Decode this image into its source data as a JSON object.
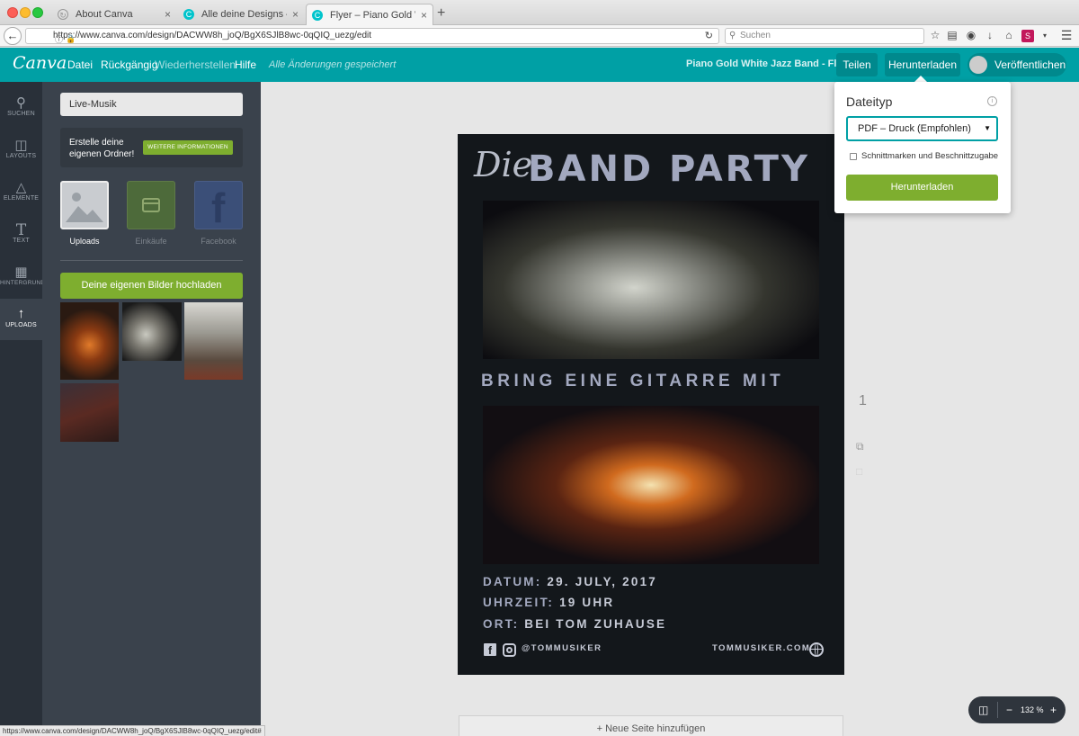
{
  "browser": {
    "tabs": [
      {
        "title": "About Canva",
        "active": false
      },
      {
        "title": "Alle deine Designs – Canva",
        "active": false
      },
      {
        "title": "Flyer – Piano Gold White Jazz",
        "active": true
      }
    ],
    "url": "https://www.canva.com/design/DACWW8h_joQ/BgX6SJlB8wc-0qQIQ_uezg/edit",
    "search_placeholder": "Suchen",
    "status_url": "https://www.canva.com/design/DACWW8h_joQ/BgX6SJlB8wc-0qQIQ_uezg/edit#"
  },
  "topbar": {
    "logo": "Canva",
    "menu": {
      "file": "Datei",
      "undo": "Rückgängig",
      "redo": "Wiederherstellen",
      "help": "Hilfe"
    },
    "saved_note": "Alle Änderungen gespeichert",
    "design_title": "Piano Gold White Jazz Band - Flyer",
    "share": "Teilen",
    "download": "Herunterladen",
    "publish": "Veröffentlichen",
    "accent_color": "#00a0a5"
  },
  "rail": {
    "search": "SUCHEN",
    "layouts": "LAYOUTS",
    "elements": "ELEMENTE",
    "text": "TEXT",
    "background": "HINTERGRUND",
    "uploads": "UPLOADS"
  },
  "panel": {
    "search_value": "Live-Musik",
    "folder_text": "Erstelle deine eigenen Ordner!",
    "folder_button": "WEITERE INFORMATIONEN",
    "sources": {
      "uploads": "Uploads",
      "purchases": "Einkäufe",
      "facebook": "Facebook"
    },
    "upload_button": "Deine eigenen Bilder hochladen"
  },
  "flyer": {
    "die": "Die",
    "title": "BAND PARTY",
    "subtitle": "BRING EINE GITARRE MIT",
    "date_label": "DATUM:",
    "date_value": "29. JULY, 2017",
    "time_label": "UHRZEIT:",
    "time_value": "19 UHR",
    "place_label": "ORT:",
    "place_value": "BEI TOM ZUHAUSE",
    "handle": "@TOMMUSIKER",
    "website": "TOMMUSIKER.COM"
  },
  "canvas": {
    "page_number": "1",
    "add_page": "+ Neue Seite hinzufügen",
    "zoom": "132 %"
  },
  "download_panel": {
    "title": "Dateityp",
    "selected_type": "PDF – Druck (Empfohlen)",
    "crop_marks_label": "Schnittmarken und Beschnittzugabe",
    "crop_marks_checked": false,
    "button": "Herunterladen",
    "button_color": "#7eae2f"
  }
}
